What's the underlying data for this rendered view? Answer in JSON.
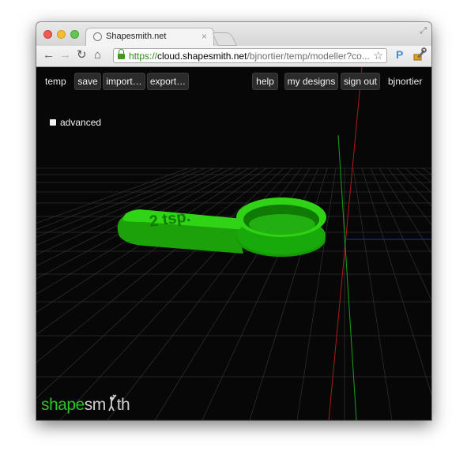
{
  "browser": {
    "tab_title": "Shapesmith.net",
    "tab_close": "×",
    "url_scheme": "https://",
    "url_host": "cloud.shapesmith.net",
    "url_path": "/bjnortier/temp/modeller?co...",
    "nav": {
      "back": "←",
      "forward": "→",
      "reload": "↻",
      "home": "⌂"
    },
    "star": "☆",
    "extension_label": "P",
    "fullscreen": "⤢"
  },
  "app": {
    "design_name": "temp",
    "buttons": {
      "save": "save",
      "import": "import…",
      "export": "export…",
      "help": "help",
      "my_designs": "my designs",
      "sign_out": "sign out"
    },
    "username": "bjnortier",
    "advanced_label": "advanced",
    "logo": {
      "shape": "shape",
      "smith_prefix": "sm",
      "smith_suffix": "th"
    },
    "model_engraving": "2 tsp.",
    "colors": {
      "model_green": "#22c20e",
      "logo_green": "#2ec028",
      "grid": "#3a3a3a",
      "axis_red": "#b01818",
      "axis_green": "#16a316",
      "axis_blue": "#1e2fb8"
    }
  }
}
